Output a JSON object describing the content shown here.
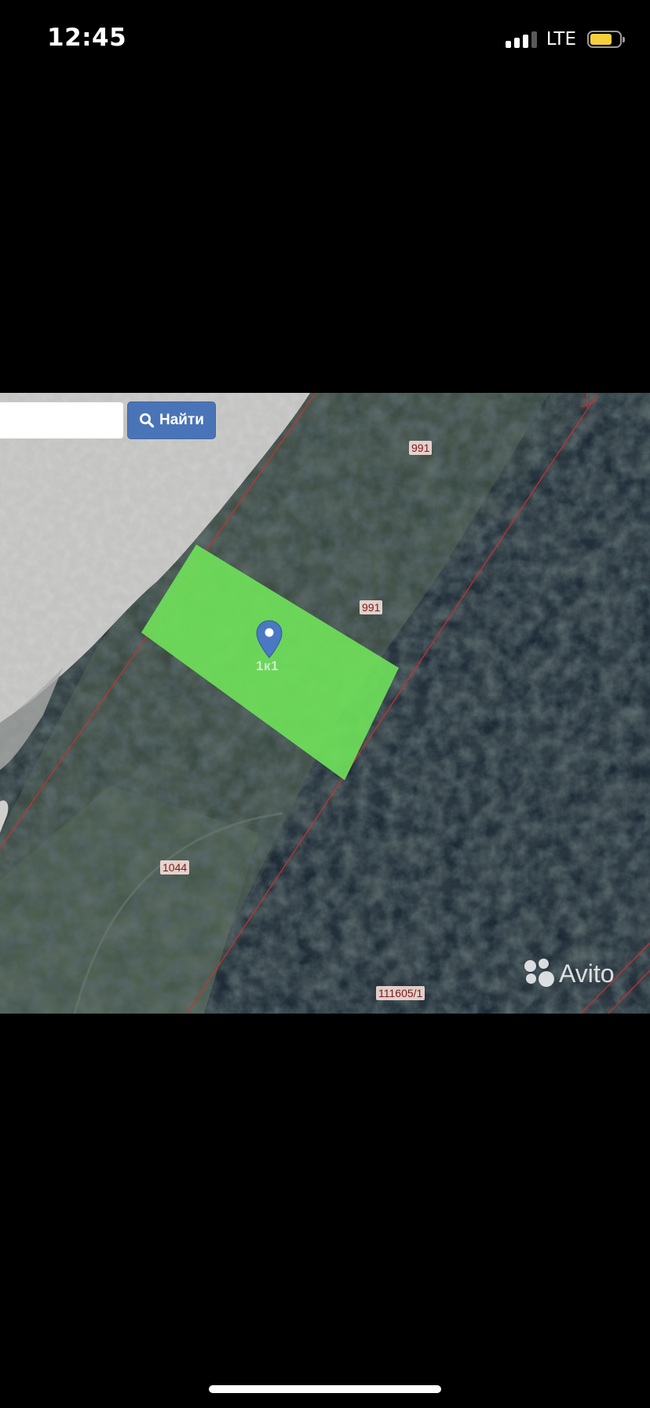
{
  "status_bar": {
    "time": "12:45",
    "network": "LTE",
    "signal_bars_active": 3,
    "signal_bars_total": 4,
    "battery_level": 0.75,
    "battery_color": "#f6cf3c"
  },
  "map": {
    "search": {
      "input_value": "",
      "button_label": "Найти",
      "button_icon": "search-icon",
      "button_color": "#4a74b8"
    },
    "parcel_labels": [
      "991",
      "991",
      "1044",
      "111605/1"
    ],
    "highlighted_parcel": {
      "label": "1к1",
      "fill_color": "#6fe25a",
      "marker_color": "#4a78c2"
    },
    "boundary_color": "#c8322d",
    "watermark": "Avito"
  }
}
